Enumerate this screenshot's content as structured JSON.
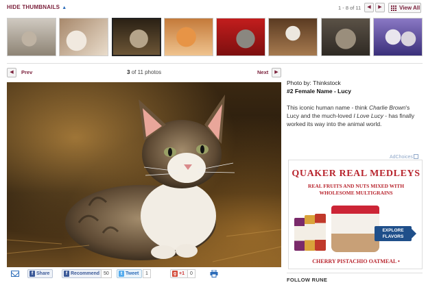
{
  "header": {
    "hide_thumbnails": "HIDE THUMBNAILS",
    "counter": "1 - 8 of 11",
    "prev_glyph": "◀",
    "next_glyph": "▶",
    "view_all": "View All"
  },
  "thumbnails": [
    {
      "name": "thumb-1"
    },
    {
      "name": "thumb-2"
    },
    {
      "name": "thumb-3",
      "active": true
    },
    {
      "name": "thumb-4"
    },
    {
      "name": "thumb-5"
    },
    {
      "name": "thumb-6"
    },
    {
      "name": "thumb-7"
    },
    {
      "name": "thumb-8"
    }
  ],
  "nav": {
    "prev": "Prev",
    "next": "Next",
    "current": "3",
    "total_text": "of 11 photos"
  },
  "caption": {
    "credit": "Photo by: Thinkstock",
    "title": "#2 Female Name - Lucy",
    "body_parts": {
      "a": "This iconic human name - think ",
      "b": "Charlie Brown",
      "c": "'s Lucy and the much-loved ",
      "d": "I Love Lucy",
      "e": " - has finally worked its way into the animal world."
    }
  },
  "ad": {
    "adchoices": "AdChoices",
    "brand": "QUAKER REAL MEDLEYS",
    "tagline_1": "REAL FRUITS AND NUTS MIXED WITH",
    "tagline_2": "WHOLESOME MULTIGRAINS",
    "explore_1": "EXPLORE",
    "explore_2": "FLAVORS",
    "flavor": "CHERRY PISTACHIO OATMEAL",
    "flavor_mark": "•"
  },
  "social": {
    "share": "Share",
    "recommend": "Recommend",
    "recommend_count": "50",
    "tweet": "Tweet",
    "tweet_count": "1",
    "plusone": "+1",
    "plusone_count": "0"
  },
  "follow": "FOLLOW RUNE",
  "colors": {
    "accent": "#7a1f3a",
    "link_blue": "#2a6bb8",
    "ad_red": "#b8252e"
  }
}
